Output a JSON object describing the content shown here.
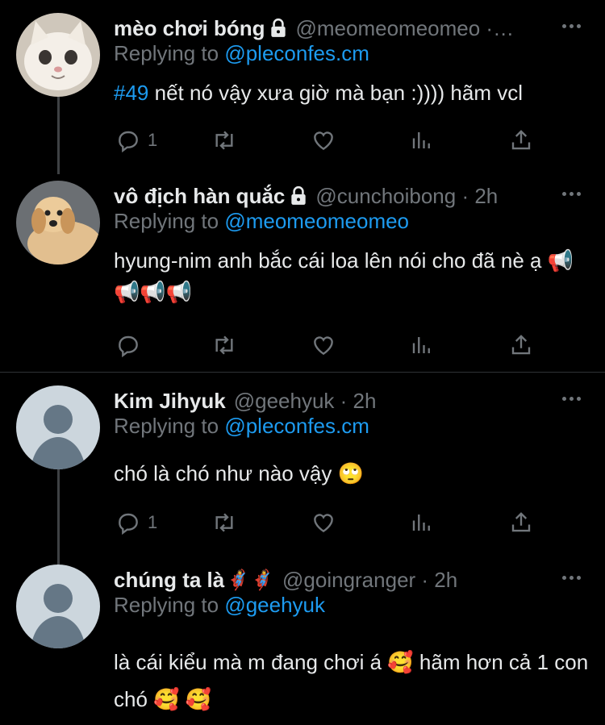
{
  "colors": {
    "background": "#000000",
    "text": "#e7e9ea",
    "muted": "#71767b",
    "accent": "#1d9bf0",
    "thread_line": "#3e4144"
  },
  "tweets": [
    {
      "name": "mèo chơi bóng",
      "protected": true,
      "handle": "@meomeomeomeo ·…",
      "replying_prefix": "Replying to",
      "replying_to": "@pleconfes.cm",
      "text_tag": "#49",
      "text": " nết nó vậy xưa giờ mà bạn :)))) hãm vcl",
      "reply_count": "1",
      "avatar": "cat-avatar"
    },
    {
      "name": "vô địch hàn quắc",
      "protected": true,
      "handle": "@cunchoibong · 2h",
      "replying_prefix": "Replying to",
      "replying_to": "@meomeomeomeo",
      "text": "hyung-nim anh bắc cái loa lên nói cho đã nè ạ 📢📢📢📢",
      "reply_count": "",
      "avatar": "puppy-avatar"
    },
    {
      "name": "Kim Jihyuk",
      "protected": false,
      "handle": "@geehyuk · 2h",
      "replying_prefix": "Replying to",
      "replying_to": "@pleconfes.cm",
      "text": "chó là chó như nào vậy 🙄",
      "reply_count": "1",
      "avatar": "default-avatar"
    },
    {
      "name": "chúng ta là",
      "name_emoji": "🦸‍♀️🦸‍♀️",
      "protected": false,
      "handle": "@goingranger · 2h",
      "replying_prefix": "Replying to",
      "replying_to": "@geehyuk",
      "text": "là cái kiểu mà m đang chơi á 🥰  hãm hơn cả 1 con chó 🥰 🥰",
      "avatar": "default-avatar"
    }
  ]
}
